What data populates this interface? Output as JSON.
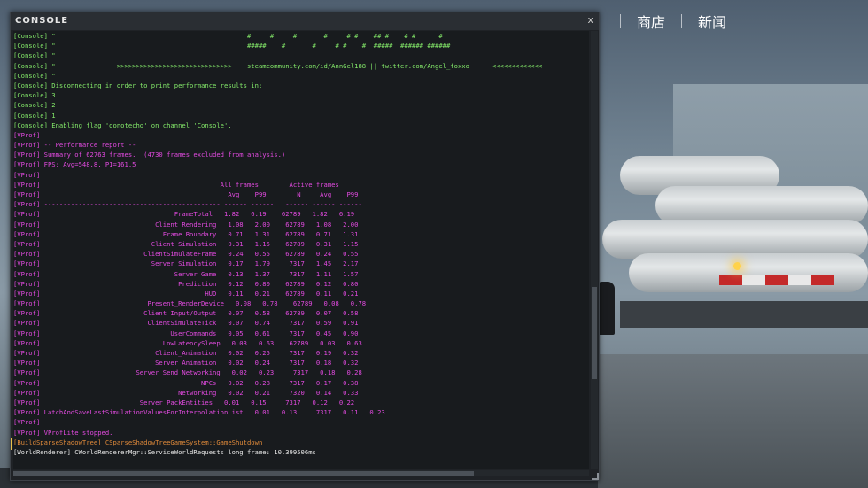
{
  "nav": {
    "items": [
      "商店",
      "新闻"
    ]
  },
  "console": {
    "title": "CONSOLE",
    "close": "x",
    "lines": [
      {
        "t": "[Console] \"                                                  #     #     #       #     # #    ## #    # #      #",
        "c": "green"
      },
      {
        "t": "[Console] \"                                                  #####    #       #     # #    #  #####  ###### ######",
        "c": "green"
      },
      {
        "t": "[Console] \"",
        "c": "green"
      },
      {
        "t": "[Console] \"                >>>>>>>>>>>>>>>>>>>>>>>>>>>>>>    steamcommunity.com/id/AnnGel188 || twitter.com/Angel_foxxo      <<<<<<<<<<<<<",
        "c": "green"
      },
      {
        "t": "[Console] \"",
        "c": "green"
      },
      {
        "t": "[Console] Disconnecting in order to print performance results in:",
        "c": "green"
      },
      {
        "t": "[Console] 3",
        "c": "green"
      },
      {
        "t": "[Console] 2",
        "c": "green"
      },
      {
        "t": "[Console] 1",
        "c": "green"
      },
      {
        "t": "[Console] Enabling flag 'donotecho' on channel 'Console'.",
        "c": "green"
      },
      {
        "t": "[VProf]",
        "c": "pink"
      },
      {
        "t": "[VProf] -- Performance report --",
        "c": "pink"
      },
      {
        "t": "[VProf] Summary of 62763 frames.  (4730 frames excluded from analysis.)",
        "c": "pink"
      },
      {
        "t": "[VProf] FPS: Avg=548.8, P1=161.5",
        "c": "pink"
      },
      {
        "t": "[VProf]",
        "c": "pink"
      },
      {
        "t": "[VProf]                                               All frames        Active frames",
        "c": "pink"
      },
      {
        "t": "[VProf]                                                 Avg    P99        N     Avg    P99",
        "c": "pink"
      },
      {
        "t": "[VProf] ---------------------------------------------- ------ ------   ------ ------ ------",
        "c": "pink"
      },
      {
        "t": "[VProf]                                   FrameTotal   1.82   6.19    62789   1.82   6.19",
        "c": "pink"
      },
      {
        "t": "[VProf]                              Client Rendering   1.08   2.00    62789   1.08   2.00",
        "c": "pink"
      },
      {
        "t": "[VProf]                                Frame Boundary   0.71   1.31    62789   0.71   1.31",
        "c": "pink"
      },
      {
        "t": "[VProf]                             Client Simulation   0.31   1.15    62789   0.31   1.15",
        "c": "pink"
      },
      {
        "t": "[VProf]                           ClientSimulateFrame   0.24   0.55    62789   0.24   0.55",
        "c": "pink"
      },
      {
        "t": "[VProf]                             Server Simulation   0.17   1.79     7317   1.45   2.17",
        "c": "pink"
      },
      {
        "t": "[VProf]                                   Server Game   0.13   1.37     7317   1.11   1.57",
        "c": "pink"
      },
      {
        "t": "[VProf]                                    Prediction   0.12   0.80    62789   0.12   0.80",
        "c": "pink"
      },
      {
        "t": "[VProf]                                           HUD   0.11   0.21    62789   0.11   0.21",
        "c": "pink"
      },
      {
        "t": "[VProf]                            Present_RenderDevice   0.08   0.78    62789   0.08   0.78",
        "c": "pink"
      },
      {
        "t": "[VProf]                           Client Input/Output   0.07   0.58    62789   0.07   0.58",
        "c": "pink"
      },
      {
        "t": "[VProf]                            ClientSimulateTick   0.07   0.74     7317   0.59   0.91",
        "c": "pink"
      },
      {
        "t": "[VProf]                                  UserCommands   0.05   0.61     7317   0.45   0.90",
        "c": "pink"
      },
      {
        "t": "[VProf]                                LowLatencySleep   0.03   0.63    62789   0.03   0.63",
        "c": "pink"
      },
      {
        "t": "[VProf]                              Client_Animation   0.02   0.25     7317   0.19   0.32",
        "c": "pink"
      },
      {
        "t": "[VProf]                              Server Animation   0.02   0.24     7317   0.18   0.32",
        "c": "pink"
      },
      {
        "t": "[VProf]                         Server Send Networking   0.02   0.23     7317   0.18   0.28",
        "c": "pink"
      },
      {
        "t": "[VProf]                                          NPCs   0.02   0.28     7317   0.17   0.38",
        "c": "pink"
      },
      {
        "t": "[VProf]                                    Networking   0.02   0.21     7320   0.14   0.33",
        "c": "pink"
      },
      {
        "t": "[VProf]                          Server PackEntities   0.01   0.15     7317   0.12   0.22",
        "c": "pink"
      },
      {
        "t": "[VProf] LatchAndSaveLastSimulationValuesForInterpolationList   0.01   0.13     7317   0.11   0.23",
        "c": "pink"
      },
      {
        "t": "[VProf]",
        "c": "pink"
      },
      {
        "t": "[VProf] VProfLite stopped.",
        "c": "pink"
      },
      {
        "t": "[BuildSparseShadowTree] CSparseShadowTreeGameSystem::GameShutdown",
        "c": "orange"
      },
      {
        "t": "[WorldRenderer] CWorldRendererMgr::ServiceWorldRequests long frame: 10.399506ms",
        "c": "white"
      }
    ]
  },
  "scroll": {
    "vertical": {
      "position": 0.74,
      "visible": 0.21
    },
    "horizontal": {
      "position": 0.0,
      "visible": 0.8
    }
  },
  "colors": {
    "green": "#84ea6a",
    "pink": "#e24ae0",
    "orange": "#e08a3a",
    "white": "#e8e8e8"
  }
}
